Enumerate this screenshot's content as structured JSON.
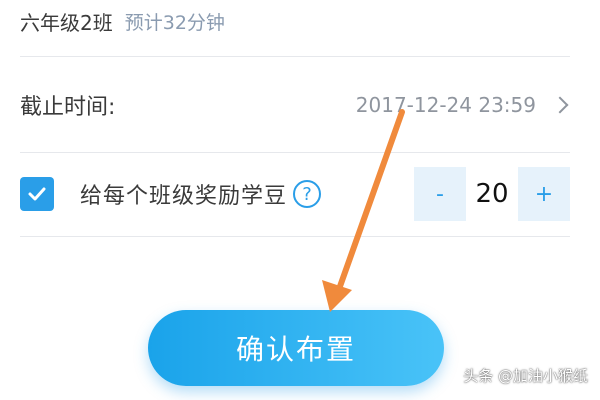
{
  "class_row": {
    "name": "六年级2班",
    "estimate": "预计32分钟"
  },
  "deadline_row": {
    "label": "截止时间:",
    "value": "2017-12-24 23:59",
    "chevron_icon": "chevron-right-icon"
  },
  "reward_row": {
    "checked": true,
    "label": "给每个班级奖励学豆",
    "help_icon": "help-circle-icon",
    "help_glyph": "?",
    "stepper": {
      "minus_label": "-",
      "value": "20",
      "plus_label": "+"
    }
  },
  "confirm_button": {
    "label": "确认布置"
  },
  "annotation": {
    "arrow_color": "#f08a3c"
  },
  "watermark": {
    "text": "头条 @加油小猴纸"
  },
  "colors": {
    "accent": "#2a9ee8",
    "muted_text": "#8f959e",
    "stepper_bg": "#e6f2fb"
  }
}
